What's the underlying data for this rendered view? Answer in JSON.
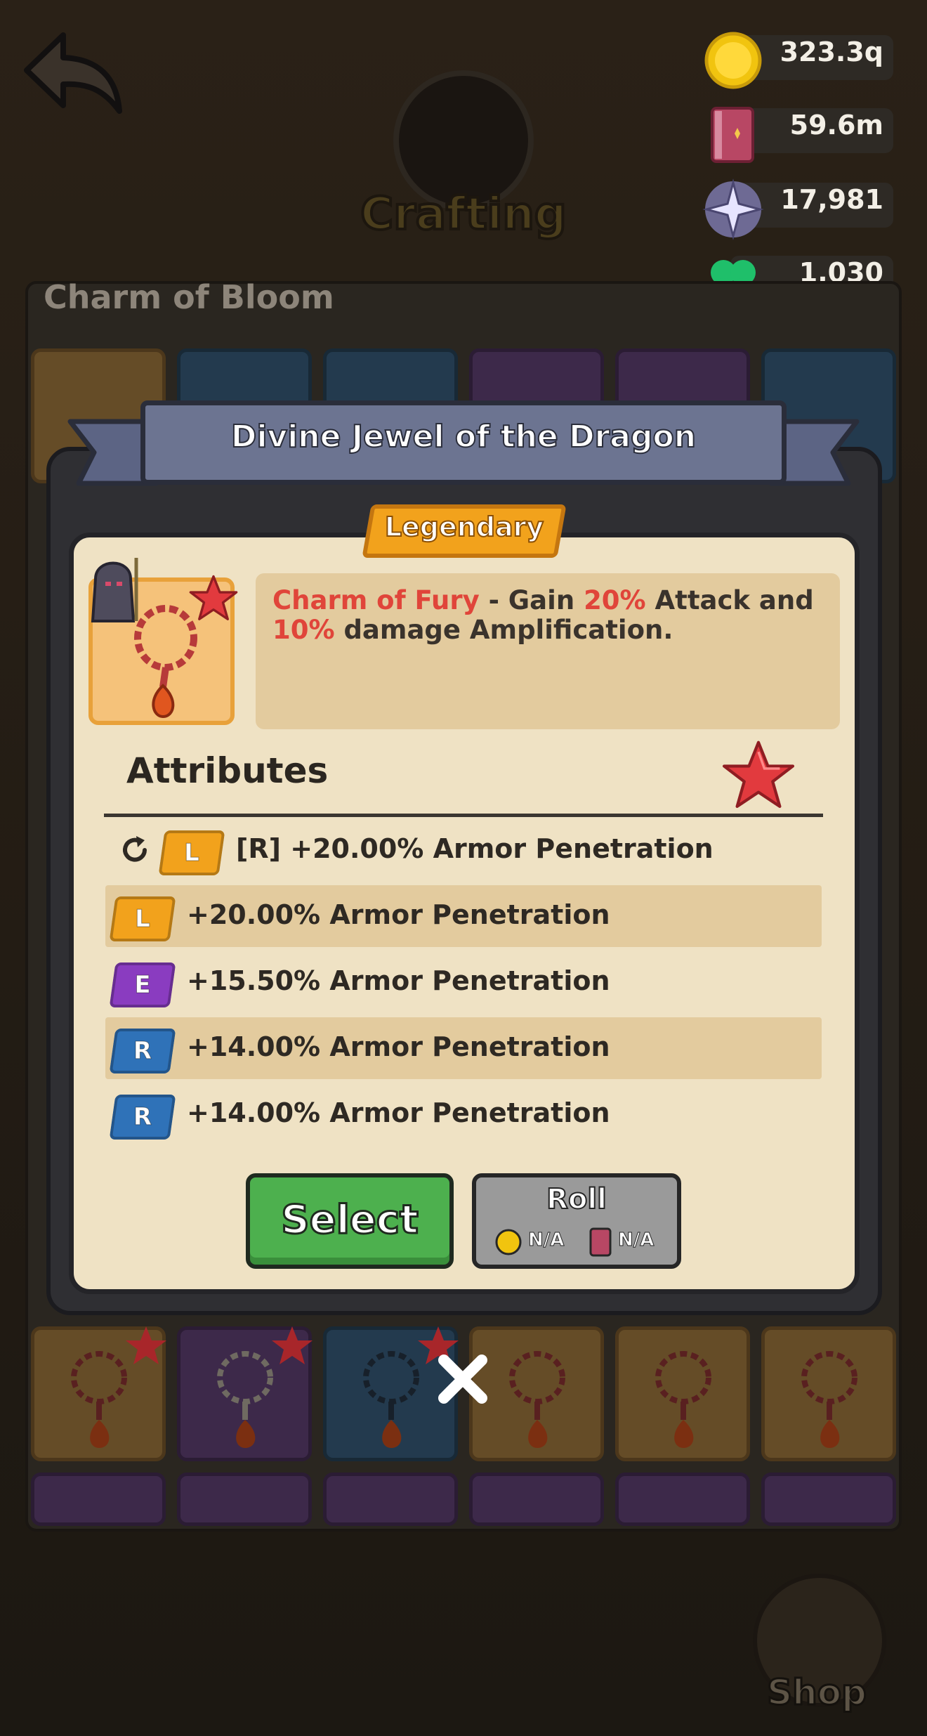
{
  "header": {
    "back_label": "",
    "screen_title": "Crafting"
  },
  "currencies": [
    {
      "icon": "gold-coin-icon",
      "value": "323.3q"
    },
    {
      "icon": "spell-book-icon",
      "value": "59.6m"
    },
    {
      "icon": "crystal-star-icon",
      "value": "17,981"
    },
    {
      "icon": "four-leaf-clover-icon",
      "value": "1,030"
    }
  ],
  "background": {
    "section_title": "Charm of Bloom",
    "shop_label": "Shop"
  },
  "modal": {
    "title": "Divine Jewel of the Dragon",
    "rarity": "Legendary",
    "description": {
      "part1": "Charm of Fury",
      "part2": " - Gain ",
      "part3": "20%",
      "part4": " Attack and ",
      "part5": "10%",
      "part6": " damage Amplification."
    },
    "attributes_title": "Attributes",
    "attributes": [
      {
        "tier": "L",
        "text": "[R] +20.00% Armor Penetration"
      },
      {
        "tier": "L",
        "text": "+20.00% Armor Penetration"
      },
      {
        "tier": "E",
        "text": "+15.50% Armor Penetration"
      },
      {
        "tier": "R",
        "text": "+14.00% Armor Penetration"
      },
      {
        "tier": "R",
        "text": "+14.00% Armor Penetration"
      }
    ],
    "select_label": "Select",
    "roll_label": "Roll",
    "roll_gold_cost": "N/A",
    "roll_book_cost": "N/A"
  },
  "colors": {
    "legendary": "#f2a21c",
    "epic": "#8a3cc0",
    "rare": "#2f72b8",
    "accent_red": "#e0453a",
    "select_green": "#4db04e"
  }
}
